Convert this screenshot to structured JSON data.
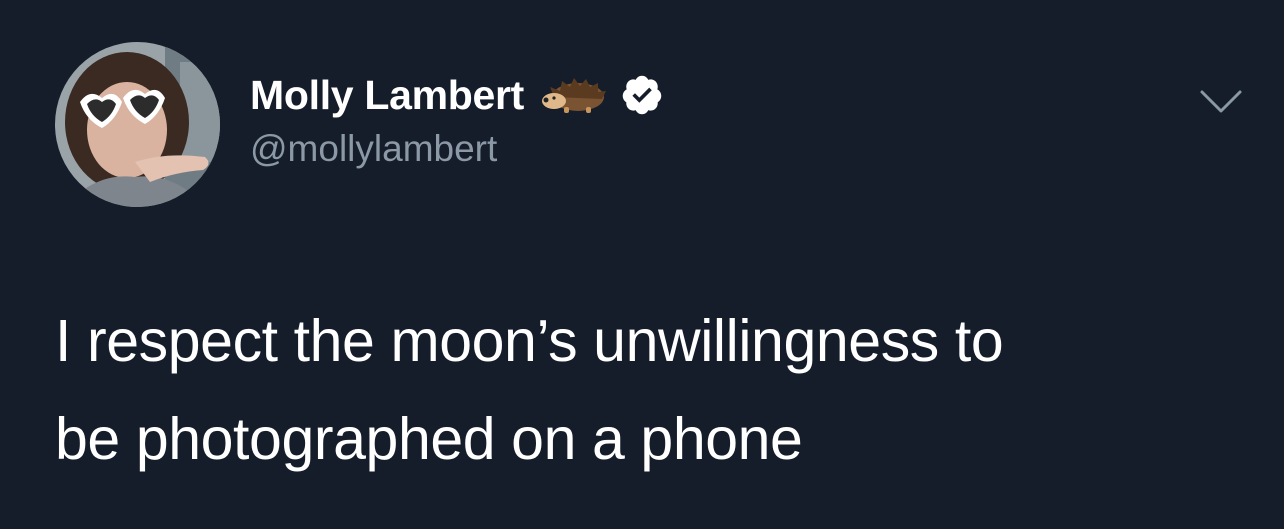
{
  "tweet": {
    "author": {
      "display_name": "Molly Lambert",
      "handle": "@mollylambert",
      "name_emoji": "hedgehog-emoji",
      "verified": true
    },
    "text_lines": [
      "I respect the moon’s unwillingness to",
      "be photographed on a phone"
    ]
  },
  "icons": {
    "avatar": "profile-photo",
    "verified": "verified-badge-icon",
    "menu": "chevron-down-icon"
  },
  "colors": {
    "background": "#151d2a",
    "text_primary": "#ffffff",
    "text_secondary": "#8b98a5"
  }
}
